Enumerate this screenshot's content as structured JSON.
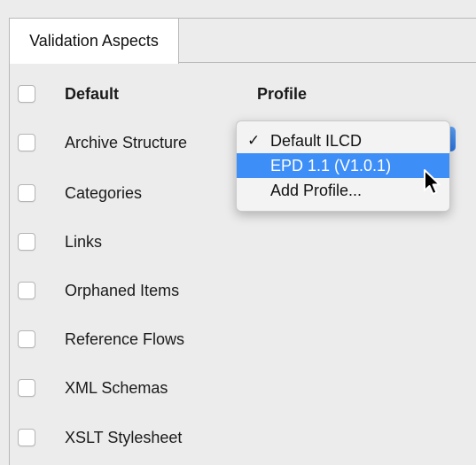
{
  "tab": {
    "label": "Validation Aspects"
  },
  "header": {
    "default_label": "Default",
    "profile_label": "Profile"
  },
  "aspects": [
    {
      "label": "Archive Structure"
    },
    {
      "label": "Categories"
    },
    {
      "label": "Links"
    },
    {
      "label": "Orphaned Items"
    },
    {
      "label": "Reference Flows"
    },
    {
      "label": "XML Schemas"
    },
    {
      "label": "XSLT Stylesheet"
    }
  ],
  "profile_menu": {
    "items": [
      {
        "label": "Default ILCD",
        "checked": true,
        "check_glyph": "✓"
      },
      {
        "label": "EPD 1.1 (V1.0.1)",
        "highlighted": true
      },
      {
        "label": "Add Profile..."
      }
    ]
  },
  "colors": {
    "highlight": "#3d8ef7",
    "select_accent": "#2c74e0",
    "background": "#ececec"
  },
  "icons": {
    "cursor": "arrow-pointer-icon",
    "check": "checkmark-icon"
  }
}
